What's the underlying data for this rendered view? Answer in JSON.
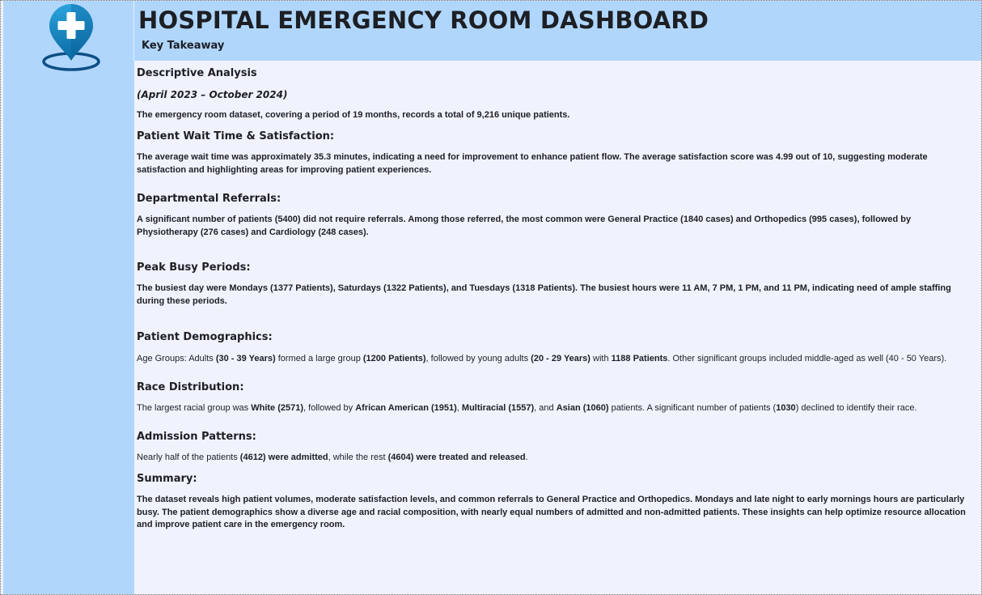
{
  "header": {
    "title": "HOSPITAL EMERGENCY ROOM DASHBOARD",
    "subtitle": "Key Takeaway"
  },
  "icons": {
    "logo": "hospital-location-pin-icon"
  },
  "colors": {
    "sidebar": "#b0d6fc",
    "header": "#b0d6fc",
    "background": "#f0f3fe",
    "logo_primary": "#1a8fc9",
    "logo_dark": "#0d5a8a"
  },
  "sections": {
    "descriptive": {
      "heading": "Descriptive Analysis",
      "period": "(April 2023 – October 2024)",
      "text": "The emergency room dataset, covering a period of 19 months, records a total of 9,216 unique patients."
    },
    "wait_time": {
      "heading": "Patient Wait Time & Satisfaction:",
      "text": "The average wait time was approximately 35.3 minutes, indicating a need for improvement to enhance patient flow. The average satisfaction score was 4.99 out of 10, suggesting moderate satisfaction and highlighting areas for improving patient experiences."
    },
    "referrals": {
      "heading": "Departmental Referrals:",
      "text": "A significant number of patients (5400) did not require referrals. Among those referred, the most common were General Practice (1840 cases) and Orthopedics (995 cases), followed by Physiotherapy (276 cases) and Cardiology (248 cases)."
    },
    "peak": {
      "heading": "Peak Busy Periods:",
      "text": "The busiest day were Mondays (1377 Patients), Saturdays (1322 Patients), and Tuesdays (1318 Patients). The busiest hours were 11 AM, 7 PM, 1 PM, and 11 PM, indicating need of ample staffing during these periods."
    },
    "demographics": {
      "heading": "Patient Demographics:",
      "t1": "Age Groups: Adults ",
      "b1": "(30 - 39 Years)",
      "t2": " formed a large group ",
      "b2": "(1200 Patients)",
      "t3": ", followed by young adults ",
      "b3": "(20 - 29 Years)",
      "t4": " with ",
      "b4": "1188 Patients",
      "t5": ". Other significant groups included middle-aged as well (40 - 50 Years)."
    },
    "race": {
      "heading": "Race Distribution:",
      "t1": "The largest racial group was ",
      "b1": "White (2571)",
      "t2": ", followed by ",
      "b2": "African American (1951)",
      "t3": ", ",
      "b3": "Multiracial (1557)",
      "t4": ", and ",
      "b4": "Asian (1060)",
      "t5": " patients. A significant number of patients (",
      "b5": "1030",
      "t6": ") declined to identify their race."
    },
    "admission": {
      "heading": "Admission Patterns:",
      "t1": "Nearly half of the patients ",
      "b1": "(4612) were admitted",
      "t2": ", while the rest ",
      "b2": "(4604) were treated and released",
      "t3": "."
    },
    "summary": {
      "heading": "Summary:",
      "text": "The dataset reveals high patient volumes, moderate satisfaction levels, and common referrals to General Practice and Orthopedics. Mondays and late night to early mornings hours are particularly busy. The patient demographics show a diverse age and racial composition, with nearly equal numbers of admitted and non-admitted patients. These insights can help optimize resource allocation and improve patient care in the emergency room."
    }
  }
}
